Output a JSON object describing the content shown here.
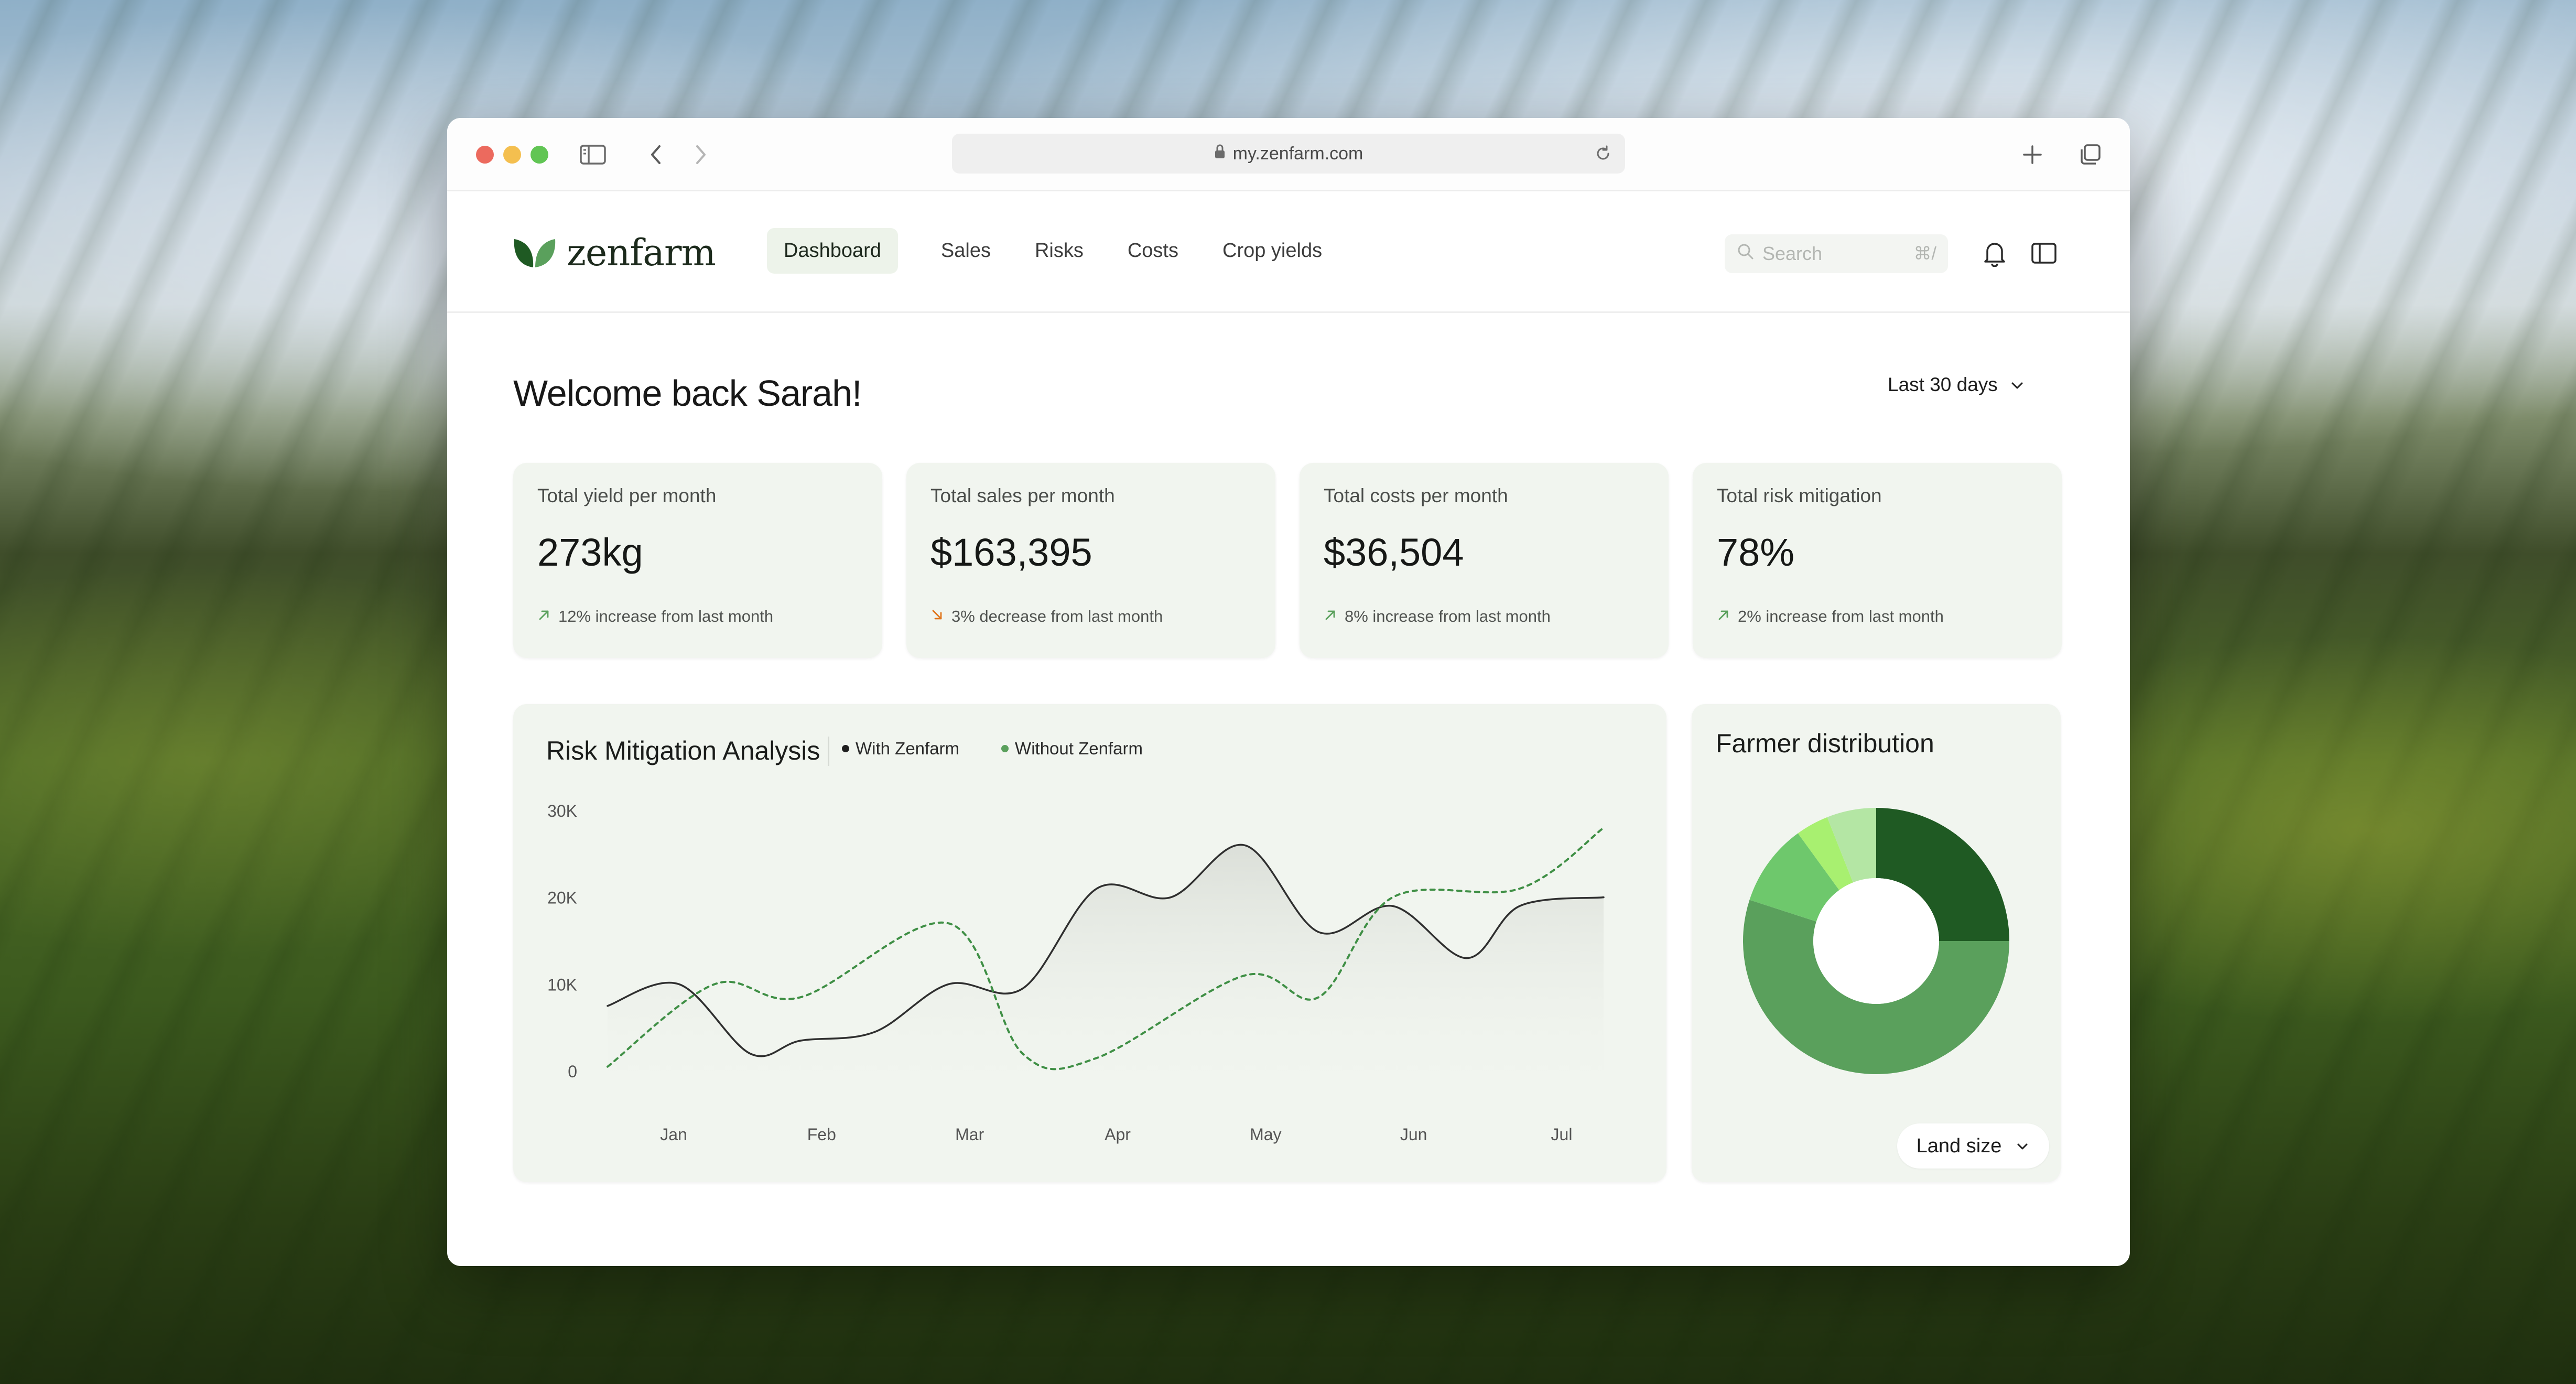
{
  "browser": {
    "url": "my.zenfarm.com"
  },
  "app": {
    "logo_text": "zenfarm",
    "nav": {
      "items": [
        {
          "label": "Dashboard",
          "active": true
        },
        {
          "label": "Sales",
          "active": false
        },
        {
          "label": "Risks",
          "active": false
        },
        {
          "label": "Costs",
          "active": false
        },
        {
          "label": "Crop yields",
          "active": false
        }
      ]
    },
    "search": {
      "placeholder": "Search",
      "shortcut": "⌘/"
    }
  },
  "main": {
    "welcome": "Welcome back Sarah!",
    "range_label": "Last 30 days",
    "stats": [
      {
        "title": "Total yield per month",
        "value": "273kg",
        "delta": "12% increase from last month",
        "direction": "up"
      },
      {
        "title": "Total sales per month",
        "value": "$163,395",
        "delta": "3% decrease from last month",
        "direction": "down"
      },
      {
        "title": "Total costs per month",
        "value": "$36,504",
        "delta": "8% increase from last month",
        "direction": "up"
      },
      {
        "title": "Total risk mitigation",
        "value": "78%",
        "delta": "2% increase from last month",
        "direction": "up"
      }
    ]
  },
  "colors": {
    "accent_dark": "#1f5a23",
    "accent_mid": "#5aa05c",
    "accent_light": "#a8e07e",
    "card_bg": "#f1f5ef",
    "arrow_up": "#5aa05c",
    "arrow_down": "#e0751c"
  },
  "chart_data": [
    {
      "type": "line",
      "title": "Risk Mitigation Analysis",
      "x": [
        "Jan",
        "Feb",
        "Mar",
        "Apr",
        "May",
        "Jun",
        "Jul"
      ],
      "series": [
        {
          "name": "With Zenfarm",
          "color": "#2f2f2f",
          "style": "solid",
          "points": [
            [
              "Jan",
              7500
            ],
            [
              "Jan",
              10000
            ],
            [
              "Jan",
              2000
            ],
            [
              "Feb",
              3500
            ],
            [
              "Feb",
              4500
            ],
            [
              "Mar",
              10000
            ],
            [
              "Mar",
              9500
            ],
            [
              "Apr",
              21000
            ],
            [
              "Apr",
              20000
            ],
            [
              "May",
              26000
            ],
            [
              "May",
              16000
            ],
            [
              "Jun",
              19000
            ],
            [
              "Jun",
              13000
            ],
            [
              "Jul",
              19000
            ],
            [
              "Jul",
              20000
            ]
          ]
        },
        {
          "name": "Without Zenfarm",
          "color": "#3f8f45",
          "style": "dashed",
          "points": [
            [
              "Jan",
              500
            ],
            [
              "Jan",
              10000
            ],
            [
              "Feb",
              8500
            ],
            [
              "Mar",
              17000
            ],
            [
              "Mar",
              2000
            ],
            [
              "Apr",
              1500
            ],
            [
              "May",
              11000
            ],
            [
              "May",
              8500
            ],
            [
              "Jun",
              20000
            ],
            [
              "Jul",
              21000
            ],
            [
              "Jul",
              28000
            ]
          ]
        }
      ],
      "y_ticks": [
        "30K",
        "20K",
        "10K",
        "0"
      ],
      "ylim": [
        0,
        30000
      ],
      "grid": false,
      "legend": "top"
    },
    {
      "type": "pie",
      "title": "Farmer distribution",
      "donut": true,
      "slices": [
        {
          "value": 25,
          "color": "#1f5a23"
        },
        {
          "value": 55,
          "color": "#5aa05c"
        },
        {
          "value": 10,
          "color": "#6ec86c"
        },
        {
          "value": 4,
          "color": "#a8f070"
        },
        {
          "value": 6,
          "color": "#b4e6a4"
        }
      ],
      "filter_label": "Land size"
    }
  ]
}
